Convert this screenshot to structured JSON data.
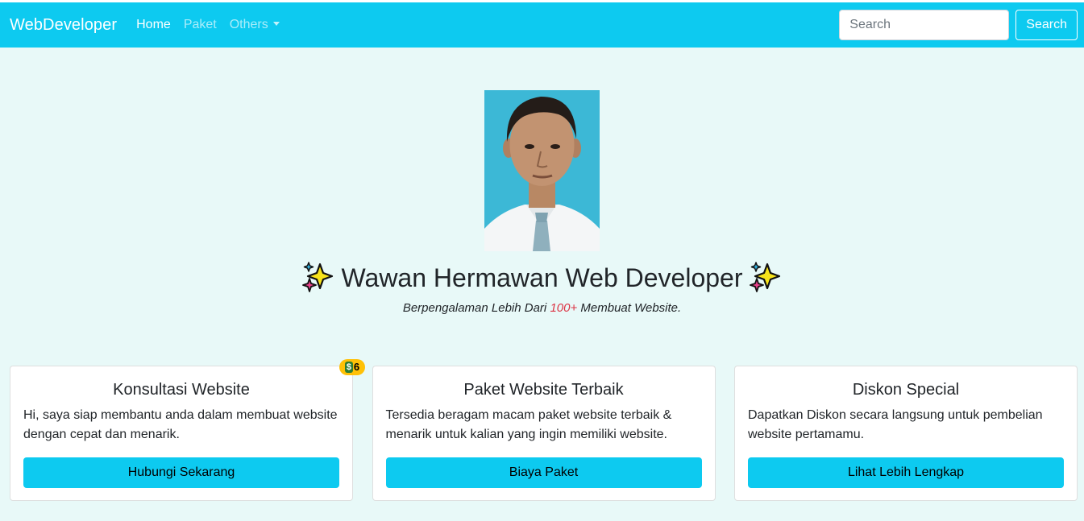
{
  "navbar": {
    "brand": "WebDeveloper",
    "links": [
      "Home",
      "Paket",
      "Others"
    ],
    "search_placeholder": "Search",
    "search_button": "Search"
  },
  "hero": {
    "title": "Wawan Hermawan Web Developer",
    "subtitle_pre": "Berpengalaman Lebih Dari ",
    "subtitle_highlight": "100+",
    "subtitle_post": " Membuat Website.",
    "icons": [
      "sparkles-icon",
      "sparkles-icon"
    ]
  },
  "cards": [
    {
      "title": "Konsultasi Website",
      "text": "Hi, saya siap membantu anda dalam membuat website dengan cepat dan menarik.",
      "button": "Hubungi Sekarang",
      "badge": "6",
      "badge_icon": "dollar-icon"
    },
    {
      "title": "Paket Website Terbaik",
      "text": "Tersedia beragam macam paket website terbaik & menarik untuk kalian yang ingin memiliki website.",
      "button": "Biaya Paket"
    },
    {
      "title": "Diskon Special",
      "text": "Dapatkan Diskon secara langsung untuk pembelian website pertamamu.",
      "button": "Lihat Lebih Lengkap"
    }
  ],
  "colors": {
    "navbar": "#0dcaf0",
    "page_bg": "#e8f9f8",
    "button": "#0dcaf0",
    "badge": "#ffc107",
    "highlight": "#dc3545"
  }
}
